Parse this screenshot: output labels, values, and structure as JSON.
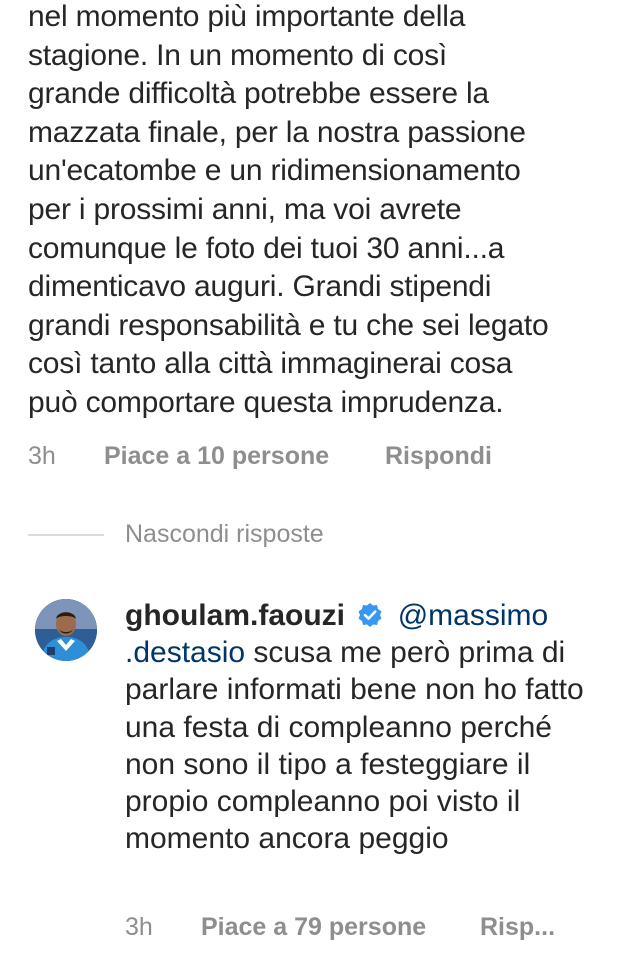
{
  "comment": {
    "text": "nel momento più importante della\nstagione. In un momento di così\ngrande difficoltà potrebbe essere la\nmazzata finale, per la nostra passione\nun'ecatombe e un ridimensionamento\nper i prossimi anni, ma voi avrete\ncomunque le foto dei tuoi 30 anni...a\ndimenticavo auguri. Grandi stipendi\ngrandi responsabilità e tu che sei legato\ncosì tanto alla città immaginerai cosa\npuò comportare questa imprudenza.",
    "time": "3h",
    "likes": "Piace a 10 persone",
    "reply_label": "Rispondi"
  },
  "hide_replies_label": "Nascondi risposte",
  "reply": {
    "username": "ghoulam.faouzi",
    "verified_icon": "verified-badge-icon",
    "mention": "@massimo .destasio",
    "text": "scusa me però prima di parlare informati bene non ho fatto una festa di compleanno perché non sono il tipo a festeggiare il propio compleanno poi visto il momento ancora peggio",
    "time": "3h",
    "likes": "Piace a 79 persone",
    "reply_label": "Risp..."
  },
  "colors": {
    "text": "#262626",
    "secondary": "#8e8e8e",
    "mention": "#003569",
    "verified": "#3897f0",
    "divider": "#dbdbdb"
  }
}
